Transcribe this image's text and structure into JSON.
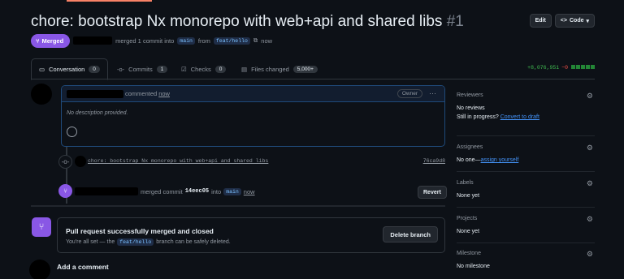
{
  "pr": {
    "title": "chore: bootstrap Nx monorepo with web+api and shared libs",
    "number": "#1",
    "status": "Merged",
    "merged_text": "merged 1 commit into",
    "base_branch": "main",
    "from_text": "from",
    "head_branch": "feat/hello",
    "time": "now"
  },
  "header_buttons": {
    "edit": "Edit",
    "code": "Code"
  },
  "tabs": [
    {
      "label": "Conversation",
      "count": "0"
    },
    {
      "label": "Commits",
      "count": "1"
    },
    {
      "label": "Checks",
      "count": "0"
    },
    {
      "label": "Files changed",
      "count": "5,000+"
    }
  ],
  "diffstat": {
    "additions": "+8,076,951",
    "deletions": "−0"
  },
  "comment": {
    "action": "commented",
    "time": "now",
    "badge": "Owner",
    "body": "No description provided."
  },
  "commit": {
    "message": "chore: bootstrap Nx monorepo with web+api and shared libs",
    "sha": "76ca9d8"
  },
  "merge_event": {
    "text": "merged commit",
    "sha": "14eec05",
    "into": "into",
    "branch": "main",
    "time": "now",
    "revert_label": "Revert"
  },
  "merged_box": {
    "title": "Pull request successfully merged and closed",
    "pre": "You're all set — the",
    "branch": "feat/hello",
    "post": "branch can be safely deleted.",
    "button": "Delete branch"
  },
  "add_comment": "Add a comment",
  "sidebar": {
    "reviewers": {
      "label": "Reviewers",
      "value": "No reviews",
      "progress_text": "Still in progress?",
      "progress_link": "Convert to draft"
    },
    "assignees": {
      "label": "Assignees",
      "value": "No one—",
      "link": "assign yourself"
    },
    "labels": {
      "label": "Labels",
      "value": "None yet"
    },
    "projects": {
      "label": "Projects",
      "value": "None yet"
    },
    "milestone": {
      "label": "Milestone",
      "value": "No milestone"
    }
  },
  "colors": {
    "merged": "#8957e5",
    "link": "#4493f8",
    "add": "#3fb950",
    "del": "#f85149"
  }
}
